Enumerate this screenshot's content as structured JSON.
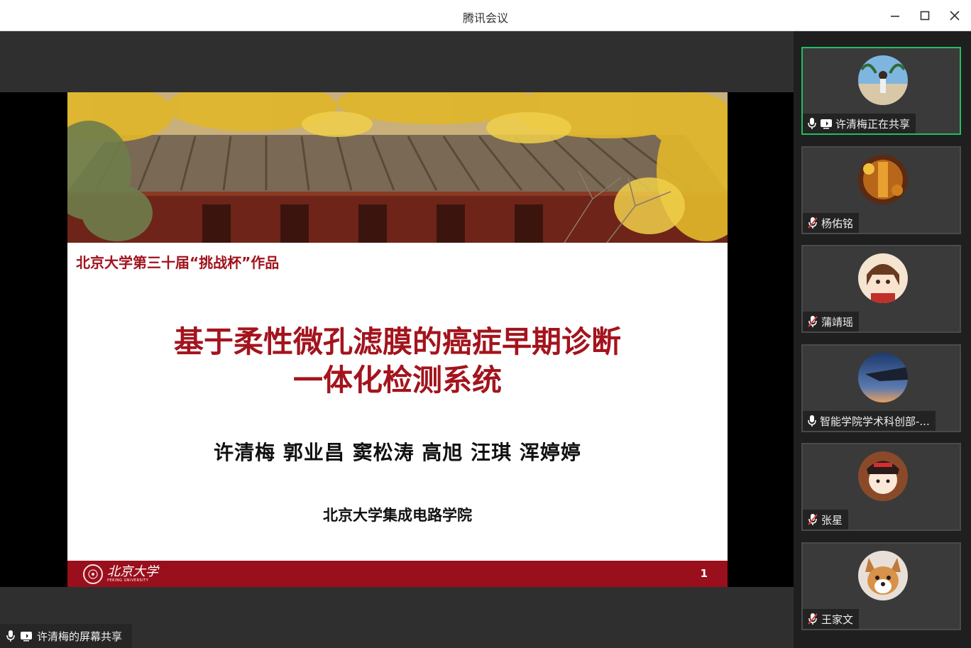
{
  "window": {
    "title": "腾讯会议",
    "minimize_icon": "minimize-icon",
    "maximize_icon": "maximize-icon",
    "close_icon": "close-icon"
  },
  "slide": {
    "tag": "北京大学第三十届“挑战杯”作品",
    "title_line1": "基于柔性微孔滤膜的癌症早期诊断",
    "title_line2": "一体化检测系统",
    "authors": "许清梅 郭业昌 窦松涛 高旭 汪琪 浑婷婷",
    "organization": "北京大学集成电路学院",
    "footer_logo_cn": "北京大学",
    "footer_logo_en": "PEKING UNIVERSITY",
    "page_number": "1",
    "accent_color": "#9a0f1c"
  },
  "share_label": {
    "text": "许清梅的屏幕共享",
    "mic_icon": "microphone-icon",
    "screen_icon": "screen-share-icon"
  },
  "participants": [
    {
      "name": "许清梅正在共享",
      "mic": "on",
      "sharing": true,
      "active": true
    },
    {
      "name": "杨佑铭",
      "mic": "muted",
      "sharing": false,
      "active": false
    },
    {
      "name": "蒲靖瑶",
      "mic": "muted",
      "sharing": false,
      "active": false
    },
    {
      "name": "智能学院学术科创部-...",
      "mic": "on",
      "sharing": false,
      "active": false
    },
    {
      "name": "张星",
      "mic": "muted",
      "sharing": false,
      "active": false
    },
    {
      "name": "王家文",
      "mic": "muted",
      "sharing": false,
      "active": false
    }
  ],
  "colors": {
    "active_speaker_border": "#1fbf5f",
    "slide_title": "#a3141d"
  }
}
